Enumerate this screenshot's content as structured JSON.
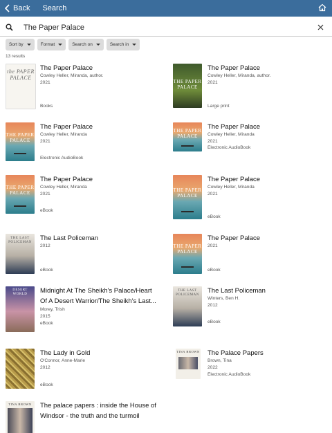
{
  "header": {
    "back_label": "Back",
    "title": "Search"
  },
  "search": {
    "value": "The Paper Palace"
  },
  "filters": [
    "Sort by",
    "Format",
    "Search on",
    "Search in"
  ],
  "results_count": "13 results",
  "results": [
    {
      "title": "The Paper Palace",
      "lines": [
        "Cowley Heller, Miranda, author.",
        "2021"
      ],
      "format": "Books",
      "cover_text": "the PAPER PALACE"
    },
    {
      "title": "The Paper Palace",
      "lines": [
        "Cowley Heller, Miranda, author.",
        "2021"
      ],
      "format": "Large print",
      "cover_text": "THE PAPER PALACE"
    },
    {
      "title": "The Paper Palace",
      "lines": [
        "Cowley Heller, Miranda",
        "2021"
      ],
      "format": "Electronic AudioBook",
      "cover_text": "THE PAPER PALACE"
    },
    {
      "title": "The Paper Palace",
      "lines": [
        "Cowley Heller, Miranda",
        "2021"
      ],
      "format": "Electronic AudioBook",
      "cover_text": "THE PAPER PALACE"
    },
    {
      "title": "The Paper Palace",
      "lines": [
        "Cowley Heller, Miranda",
        "2021"
      ],
      "format": "eBook",
      "cover_text": "THE PAPER PALACE"
    },
    {
      "title": "The Paper Palace",
      "lines": [
        "Cowley Heller, Miranda",
        "2021"
      ],
      "format": "eBook",
      "cover_text": "THE PAPER PALACE"
    },
    {
      "title": "The Last Policeman",
      "lines": [
        "2012"
      ],
      "format": "eBook",
      "cover_text": "THE LAST POLICEMAN"
    },
    {
      "title": "The Paper Palace",
      "lines": [
        "2021"
      ],
      "format": "eBook",
      "cover_text": "THE PAPER PALACE"
    },
    {
      "title": "Midnight At The Sheikh's Palace/Heart Of A Desert Warrior/The Sheikh's Last...",
      "lines": [
        "Morey, Trish",
        "2015"
      ],
      "format": "eBook",
      "cover_text": "DESERT WORLD"
    },
    {
      "title": "The Last Policeman",
      "lines": [
        "Winters, Ben H.",
        "2012"
      ],
      "format": "eBook",
      "cover_text": "THE LAST POLICEMAN"
    },
    {
      "title": "The Lady in Gold",
      "lines": [
        "O'Connor, Anne-Marie",
        "2012"
      ],
      "format": "eBook",
      "cover_text": ""
    },
    {
      "title": "The Palace Papers",
      "lines": [
        "Brown, Tina",
        "2022"
      ],
      "format": "Electronic AudioBook",
      "cover_text": "TINA BROWN"
    },
    {
      "title": "The palace papers : inside the House of Windsor - the truth and the turmoil",
      "lines": [],
      "format": "",
      "cover_text": "TINA BROWN"
    }
  ]
}
